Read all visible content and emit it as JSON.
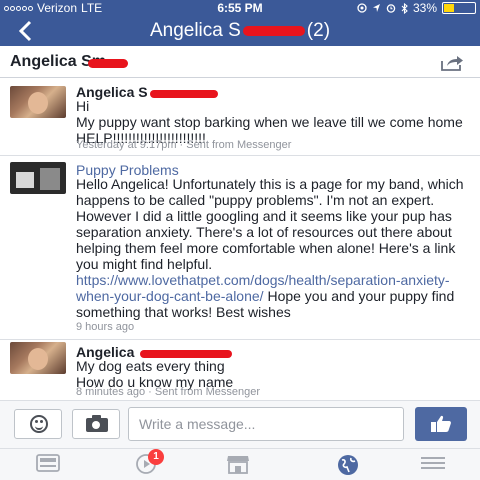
{
  "status_bar": {
    "carrier": "Verizon",
    "network": "LTE",
    "time": "6:55 PM",
    "battery_text": "33%",
    "battery_level": 0.33,
    "icons": [
      "location-icon",
      "arrow-icon",
      "alarm-icon",
      "bluetooth-icon"
    ]
  },
  "nav": {
    "back_icon": "chevron-left-icon",
    "title_first": "Angelica S",
    "title_count": "(2)"
  },
  "sub_header": {
    "name": "Angelica Sm",
    "share_icon": "share-icon"
  },
  "messages": [
    {
      "sender": "Angelica S",
      "lines": [
        "Hi",
        "My puppy want stop barking when we leave till we come home HELP!!!!!!!!!!!!!!!!!!!!!!!!"
      ],
      "meta": "Yesterday at 9:17pm · Sent from Messenger"
    },
    {
      "sender": "Puppy Problems",
      "text_before_link": "Hello Angelica! Unfortunately this is a page for my band, which happens to be called \"puppy problems\". I'm not an expert. However I did a little googling and it seems like your pup has separation anxiety. There's a lot of resources out there about helping them feel more comfortable when alone! Here's a link you might find helpful. ",
      "link": "https://www.lovethatpet.com/dogs/health/separation-anxiety-when-your-dog-cant-be-alone/",
      "text_after_link": " Hope you and your puppy find something that works! Best wishes",
      "meta": "9 hours ago"
    },
    {
      "sender": "Angelica",
      "lines": [
        "My dog eats every thing",
        "How do u know my name"
      ],
      "meta": "8 minutes ago · Sent from Messenger"
    }
  ],
  "composer": {
    "placeholder": "Write a message...",
    "emoji_icon": "emoji-icon",
    "camera_icon": "camera-icon",
    "like_icon": "thumbs-up-icon"
  },
  "tab_bar": {
    "tabs": [
      {
        "icon": "news-feed-icon"
      },
      {
        "icon": "video-icon",
        "badge": "1"
      },
      {
        "icon": "marketplace-icon"
      },
      {
        "icon": "globe-icon"
      },
      {
        "icon": "menu-icon"
      }
    ]
  },
  "colors": {
    "brand": "#3b5998",
    "link": "#4e69a2",
    "redaction": "#e8141d",
    "badge": "#fa3e3e"
  }
}
